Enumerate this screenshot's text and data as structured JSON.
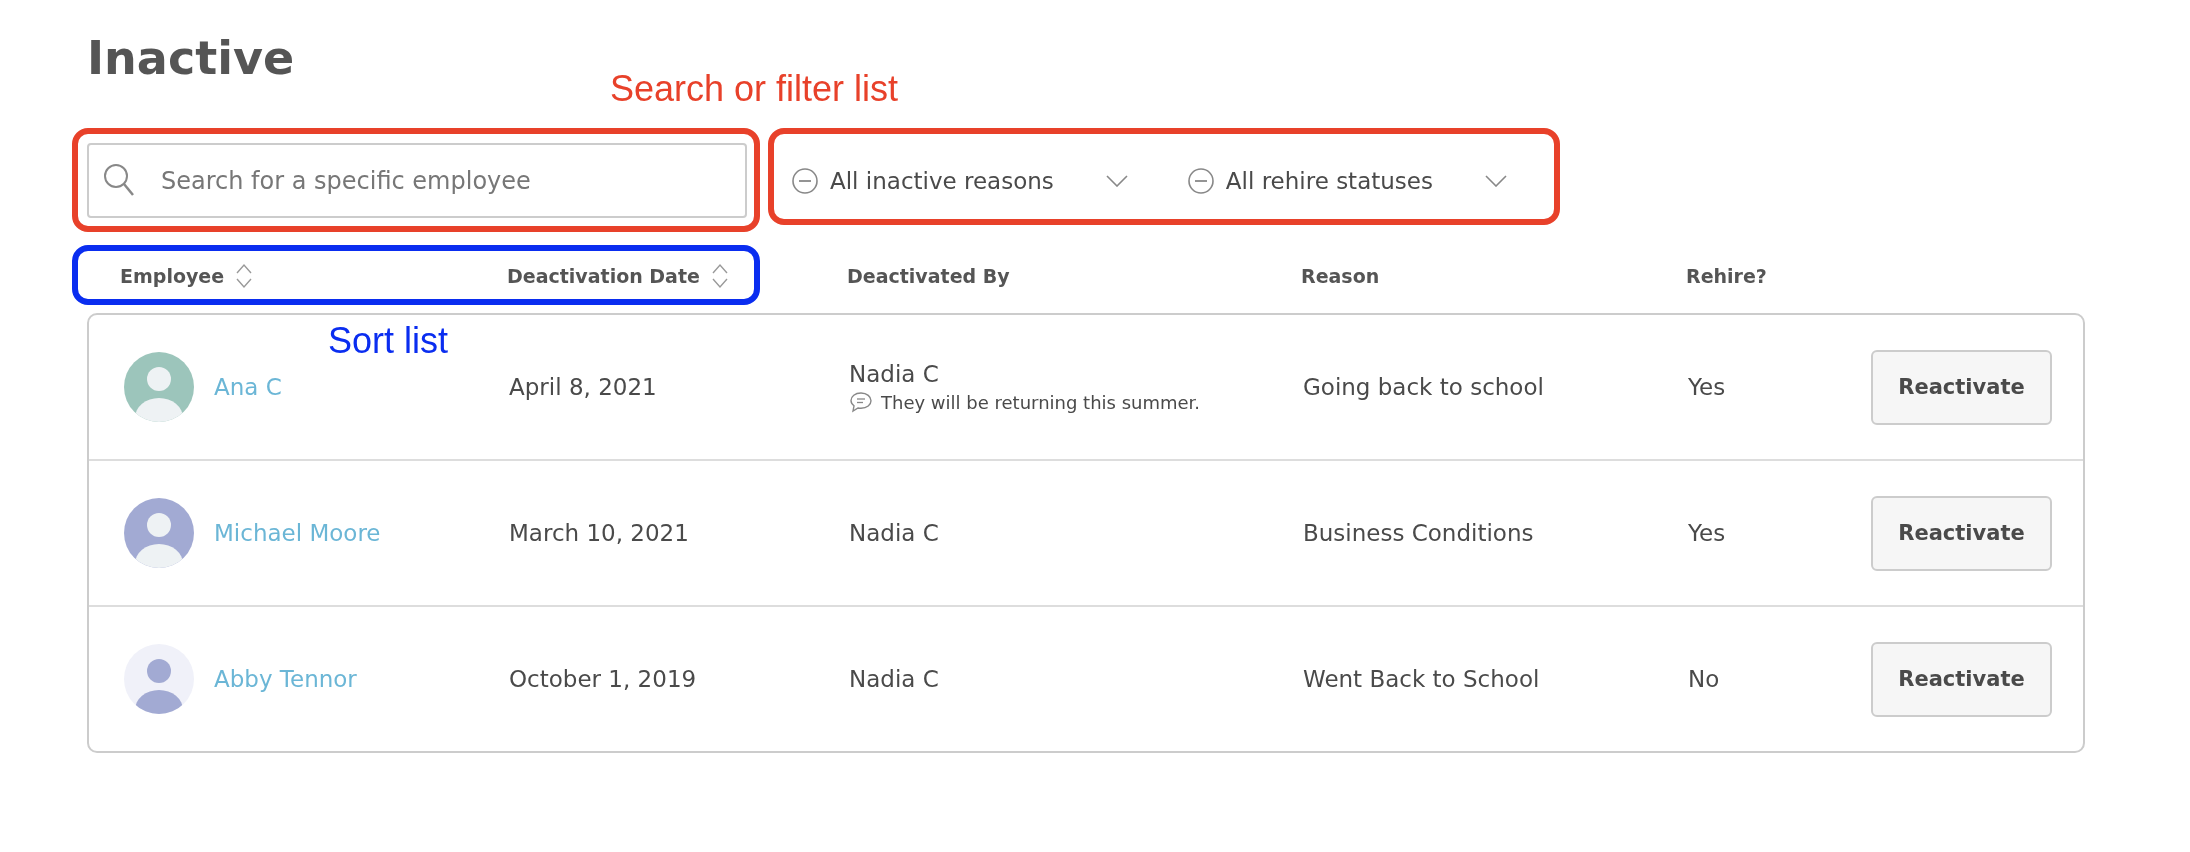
{
  "page": {
    "title": "Inactive"
  },
  "search": {
    "placeholder": "Search for a specific employee"
  },
  "filters": [
    {
      "label": "All inactive reasons"
    },
    {
      "label": "All rehire statuses"
    }
  ],
  "columns": [
    {
      "label": "Employee",
      "sortable": true
    },
    {
      "label": "Deactivation Date",
      "sortable": true
    },
    {
      "label": "Deactivated By",
      "sortable": false
    },
    {
      "label": "Reason",
      "sortable": false
    },
    {
      "label": "Rehire?",
      "sortable": false
    }
  ],
  "rows": [
    {
      "employee": "Ana C",
      "avatar": {
        "kind": "filled",
        "color": "#9cc5bb"
      },
      "date": "April 8, 2021",
      "deactivated_by": "Nadia C",
      "note": "They will be returning this summer.",
      "reason": "Going back to school",
      "rehire": "Yes",
      "action": "Reactivate"
    },
    {
      "employee": "Michael Moore",
      "avatar": {
        "kind": "filled",
        "color": "#a2aad3"
      },
      "date": "March 10, 2021",
      "deactivated_by": "Nadia C",
      "reason": "Business Conditions",
      "rehire": "Yes",
      "action": "Reactivate"
    },
    {
      "employee": "Abby Tennor",
      "avatar": {
        "kind": "light",
        "color": "#a2aad3"
      },
      "date": "October 1, 2019",
      "deactivated_by": "Nadia C",
      "reason": "Went Back to School",
      "rehire": "No",
      "action": "Reactivate"
    }
  ],
  "annotations": [
    {
      "text": "Search or filter list",
      "color": "#e8412a"
    },
    {
      "text": "Sort list",
      "color": "#0a2df0"
    }
  ]
}
